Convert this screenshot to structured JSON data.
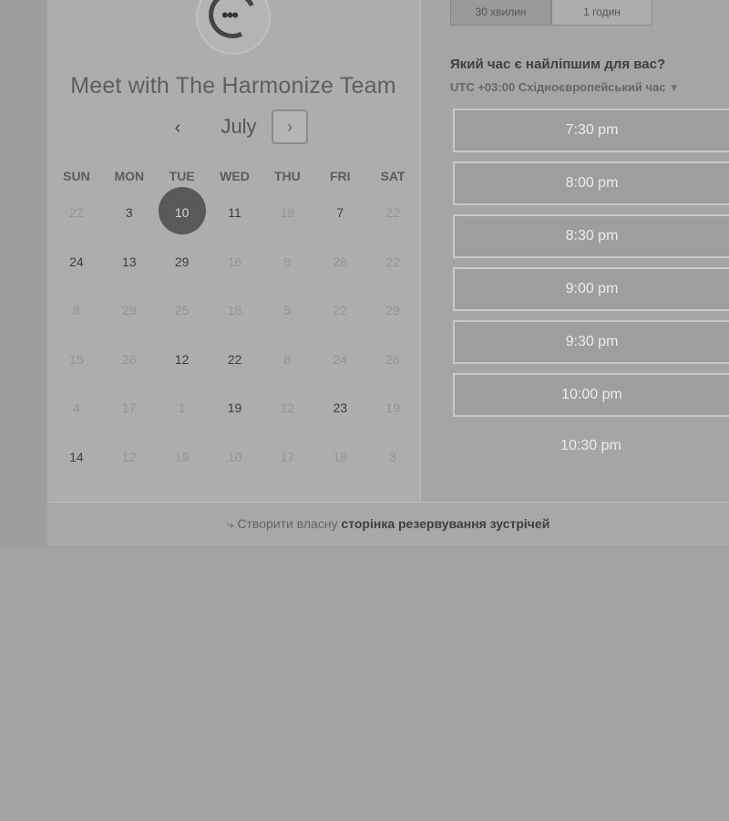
{
  "booking": {
    "title": "Meet with The Harmonize Team",
    "month": "July",
    "prev_icon": "‹",
    "next_icon": "›"
  },
  "durations": [
    {
      "label": "30 хвилин",
      "active": true
    },
    {
      "label": "1 годин",
      "active": false
    }
  ],
  "calendar": {
    "weekdays": [
      "SUN",
      "MON",
      "TUE",
      "WED",
      "THU",
      "FRI",
      "SAT"
    ],
    "weeks": [
      [
        [
          "22",
          "dim"
        ],
        [
          "3",
          "avail"
        ],
        [
          "10",
          "selected"
        ],
        [
          "11",
          "avail"
        ],
        [
          "18",
          "dim"
        ],
        [
          "7",
          "avail"
        ],
        [
          "22",
          "dim"
        ]
      ],
      [
        [
          "24",
          "avail"
        ],
        [
          "13",
          "avail"
        ],
        [
          "29",
          "avail"
        ],
        [
          "16",
          "dim"
        ],
        [
          "8",
          "dim"
        ],
        [
          "28",
          "dim"
        ],
        [
          "22",
          "dim"
        ]
      ],
      [
        [
          "8",
          "dim"
        ],
        [
          "29",
          "dim"
        ],
        [
          "25",
          "dim"
        ],
        [
          "18",
          "dim"
        ],
        [
          "5",
          "dim"
        ],
        [
          "22",
          "dim"
        ],
        [
          "29",
          "dim"
        ]
      ],
      [
        [
          "15",
          "dim"
        ],
        [
          "28",
          "dim"
        ],
        [
          "12",
          "avail"
        ],
        [
          "22",
          "avail"
        ],
        [
          "8",
          "dim"
        ],
        [
          "24",
          "dim"
        ],
        [
          "28",
          "dim"
        ]
      ],
      [
        [
          "4",
          "dim"
        ],
        [
          "17",
          "dim"
        ],
        [
          "1",
          "dim"
        ],
        [
          "19",
          "avail"
        ],
        [
          "12",
          "dim"
        ],
        [
          "23",
          "avail"
        ],
        [
          "19",
          "dim"
        ]
      ],
      [
        [
          "14",
          "avail"
        ],
        [
          "12",
          "dim"
        ],
        [
          "19",
          "dim"
        ],
        [
          "10",
          "dim"
        ],
        [
          "17",
          "dim"
        ],
        [
          "18",
          "dim"
        ],
        [
          "3",
          "dim"
        ]
      ]
    ]
  },
  "times": {
    "question": "Який час є найліпшим для вас?",
    "timezone": "UTC +03:00 Східноєвропейський час",
    "timezone_caret": "▾",
    "slots": [
      "7:30 pm",
      "8:00 pm",
      "8:30 pm",
      "9:00 pm",
      "9:30 pm",
      "10:00 pm",
      "10:30 pm"
    ]
  },
  "footer": {
    "prefix": "Створити власну",
    "link": "сторінка резервування зустрічей"
  }
}
